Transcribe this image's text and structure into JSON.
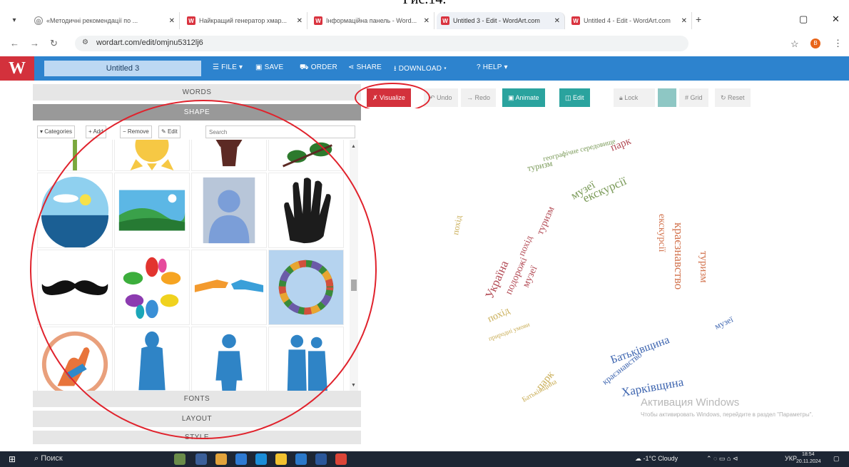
{
  "caption": "Рис.14.",
  "browser": {
    "tabs": [
      {
        "title": "«Методичні рекомендації по ...",
        "icon": "globe-icon"
      },
      {
        "title": "Найкращий генератор хмар...",
        "icon": "wordart-icon"
      },
      {
        "title": "Інформаційна панель - Word...",
        "icon": "wordart-icon"
      },
      {
        "title": "Untitled 3 - Edit - WordArt.com",
        "icon": "wordart-icon"
      },
      {
        "title": "Untitled 4 - Edit - WordArt.com",
        "icon": "wordart-icon"
      }
    ],
    "url": "wordart.com/edit/omjnu5312lj6",
    "profile_initial": "B"
  },
  "app": {
    "logo": "W",
    "doc_name": "Untitled 3",
    "menu": {
      "file": "☰ FILE ▾",
      "save": "SAVE",
      "order": "ORDER",
      "share": "SHARE",
      "download": "DOWNLOAD ▾",
      "help": "? HELP ▾"
    }
  },
  "left_panel": {
    "sections": {
      "words": "WORDS",
      "shape": "SHAPE",
      "fonts": "FONTS",
      "layout": "LAYOUT",
      "style": "STYLE"
    },
    "toolbar": {
      "categories": "Categories",
      "add": "Add",
      "remove": "Remove",
      "edit": "Edit",
      "search_placeholder": "Search"
    }
  },
  "canvas_toolbar": {
    "visualize": "Visualize",
    "undo": "Undo",
    "redo": "Redo",
    "animate": "Animate",
    "edit": "Edit",
    "lock": "Lock",
    "grid": "Grid",
    "reset": "Reset"
  },
  "cloud_words": [
    {
      "text": "парк",
      "color": "#b24a54"
    },
    {
      "text": "екскурсії",
      "color": "#7a9a58"
    },
    {
      "text": "музеї",
      "color": "#7a9a58"
    },
    {
      "text": "туризм",
      "color": "#7a9a58"
    },
    {
      "text": "географічне середовище",
      "color": "#7a9a58"
    },
    {
      "text": "екскурсії",
      "color": "#d2734e"
    },
    {
      "text": "краєзнавство",
      "color": "#d2734e"
    },
    {
      "text": "туризм",
      "color": "#d2734e"
    },
    {
      "text": "Україна",
      "color": "#b24a54"
    },
    {
      "text": "подорожі",
      "color": "#b24a54"
    },
    {
      "text": "музеї",
      "color": "#b24a54"
    },
    {
      "text": "туризм",
      "color": "#b24a54"
    },
    {
      "text": "похід",
      "color": "#b24a54"
    },
    {
      "text": "похід",
      "color": "#c9ad55"
    },
    {
      "text": "похід",
      "color": "#c9ad55"
    },
    {
      "text": "парк",
      "color": "#c9ad55"
    },
    {
      "text": "природні умови",
      "color": "#c9ad55"
    },
    {
      "text": "Батьківщина",
      "color": "#c9ad55"
    },
    {
      "text": "Батьківщина",
      "color": "#3f66b0"
    },
    {
      "text": "Харківщина",
      "color": "#3f66b0"
    },
    {
      "text": "краєзнавство",
      "color": "#3f66b0"
    },
    {
      "text": "музеї",
      "color": "#3f66b0"
    }
  ],
  "watermark": {
    "title": "Активация Windows",
    "subtitle": "Чтобы активировать Windows, перейдите в раздел \"Параметры\"."
  },
  "taskbar": {
    "search": "Поиск",
    "weather": "-1°C Cloudy",
    "lang": "УКР",
    "time": "18:54",
    "date": "20.11.2024"
  }
}
